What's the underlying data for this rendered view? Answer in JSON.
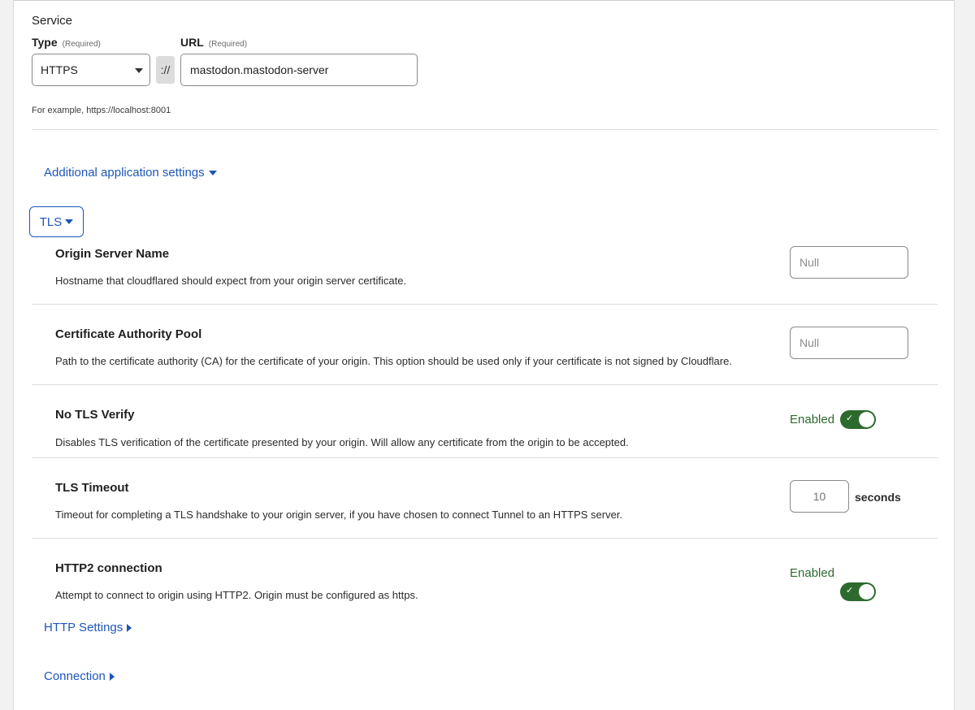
{
  "service": {
    "title": "Service",
    "type_label": "Type",
    "type_required": "(Required)",
    "type_value": "HTTPS",
    "separator": "://",
    "url_label": "URL",
    "url_required": "(Required)",
    "url_value": "mastodon.mastodon-server",
    "hint": "For example, https://localhost:8001"
  },
  "links": {
    "additional_settings": "Additional application settings",
    "tls": "TLS",
    "http_settings": "HTTP Settings",
    "connection": "Connection"
  },
  "settings": {
    "origin_server_name": {
      "title": "Origin Server Name",
      "description": "Hostname that cloudflared should expect from your origin server certificate.",
      "placeholder": "Null"
    },
    "ca_pool": {
      "title": "Certificate Authority Pool",
      "description": "Path to the certificate authority (CA) for the certificate of your origin. This option should be used only if your certificate is not signed by Cloudflare.",
      "placeholder": "Null"
    },
    "no_tls_verify": {
      "title": "No TLS Verify",
      "description": "Disables TLS verification of the certificate presented by your origin. Will allow any certificate from the origin to be accepted.",
      "status": "Enabled",
      "enabled": true
    },
    "tls_timeout": {
      "title": "TLS Timeout",
      "description": "Timeout for completing a TLS handshake to your origin server, if you have chosen to connect Tunnel to an HTTPS server.",
      "placeholder": "10",
      "unit": "seconds"
    },
    "http2": {
      "title": "HTTP2 connection",
      "description": "Attempt to connect to origin using HTTP2. Origin must be configured as https.",
      "status": "Enabled",
      "enabled": true
    }
  },
  "colors": {
    "link": "#1e56b8",
    "toggle_on": "#2d6a2e"
  },
  "icons": {
    "dropdown": "chevron-down-icon",
    "expand": "chevron-right-icon",
    "check": "check-icon"
  }
}
